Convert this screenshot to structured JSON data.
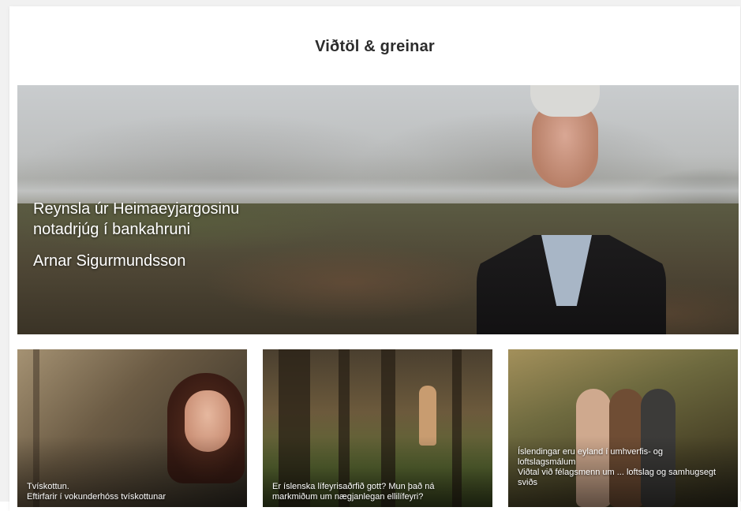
{
  "section": {
    "title": "Viðtöl & greinar"
  },
  "hero": {
    "headline": "Reynsla úr Heimaeyjargosinu notadrjúg í bankahruni",
    "byline": "Arnar Sigurmundsson"
  },
  "articles": [
    {
      "title": "Tvískottun.",
      "subtitle": "Eftirfarir í vokunderhóss tvískottunar"
    },
    {
      "title": "Er íslenska lífeyrisaðrfið gott? Mun það ná markmiðum um nægjanlegan ellilífeyri?",
      "subtitle": ""
    },
    {
      "title": "Íslendingar eru eyland í umhverfis- og loftslagsmálum",
      "subtitle": "Viðtal við félagsmenn um ... loftslag og samhugsegt sviðs"
    }
  ],
  "colors": {
    "page_bg": "#f1f1f1",
    "card_bg": "#ffffff",
    "title_text": "#2c2c2c",
    "caption_text": "#ffffff"
  }
}
